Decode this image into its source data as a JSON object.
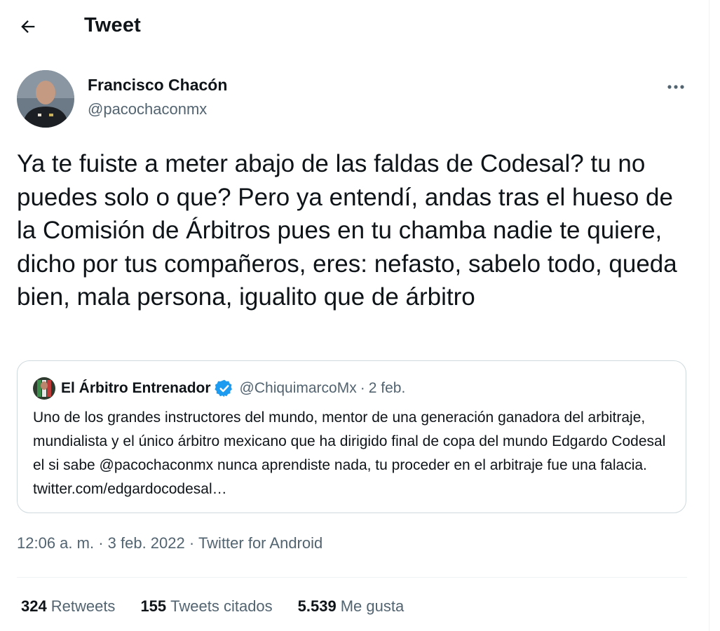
{
  "header": {
    "back_icon": "arrow-left-icon",
    "title": "Tweet"
  },
  "tweet": {
    "author": {
      "name": "Francisco Chacón",
      "handle": "@pacochaconmx"
    },
    "more_icon": "more-horizontal-icon",
    "text": "Ya te fuiste a meter abajo de las faldas de Codesal? tu no puedes solo o que? Pero ya entendí, andas tras el hueso de la Comisión de Árbitros pues en tu chamba nadie te quiere, dicho por tus compañeros, eres: nefasto, sabelo todo, queda bien, mala persona, igualito que de árbitro",
    "quoted": {
      "name": "El Árbitro Entrenador",
      "verified_icon": "verified-badge-icon",
      "handle": "@ChiquimarcoMx",
      "separator": "·",
      "date": "2 feb.",
      "text": "Uno de los grandes instructores del mundo, mentor de una generación ganadora del arbitraje, mundialista y el único árbitro mexicano que ha dirigido final de copa del mundo Edgardo Codesal el si sabe @pacochaconmx nunca aprendiste nada, tu proceder en el arbitraje fue una falacia. twitter.com/edgardocodesal…"
    },
    "meta": {
      "time": "12:06 a. m.",
      "sep1": "·",
      "date": "3 feb. 2022",
      "sep2": "·",
      "source": "Twitter for Android"
    },
    "stats": {
      "retweets_count": "324",
      "retweets_label": "Retweets",
      "quotes_count": "155",
      "quotes_label": "Tweets citados",
      "likes_count": "5.539",
      "likes_label": "Me gusta"
    }
  },
  "colors": {
    "text_primary": "#0f1419",
    "text_secondary": "#536471",
    "border": "#cfd9de",
    "verified_blue": "#1d9bf0"
  }
}
